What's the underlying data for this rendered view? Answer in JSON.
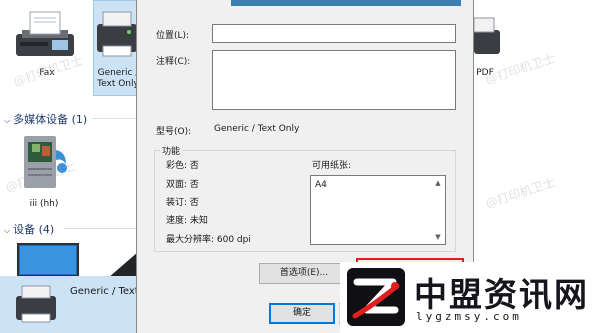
{
  "background": {
    "printers": [
      {
        "label": "Fax"
      },
      {
        "label": "Generic / Text Only"
      },
      {
        "label": "PDF"
      }
    ],
    "sections": {
      "multimedia": "多媒体设备 (1)",
      "devices": "设备 (4)"
    },
    "media_device_label": "iii (hh)",
    "bottom_item_label": "Generic / Text C",
    "watermark": "@打印机卫士"
  },
  "dialog": {
    "location_label": "位置(L):",
    "comment_label": "注释(C):",
    "model_label": "型号(O):",
    "model_value": "Generic / Text Only",
    "features_title": "功能",
    "features": {
      "color": "彩色: 否",
      "duplex": "双面: 否",
      "staple": "装订: 否",
      "speed": "速度: 未知",
      "max_dpi": "最大分辨率: 600 dpi"
    },
    "paper_label": "可用纸张:",
    "paper_items": [
      "A4"
    ],
    "preferences_button": "首选项(E)...",
    "ok_button": "确定",
    "colors": {
      "accent": "#0078d7",
      "highlight": "#e02020"
    }
  },
  "logo": {
    "title": "中盟资讯网",
    "url": "lygzmsy.com"
  }
}
